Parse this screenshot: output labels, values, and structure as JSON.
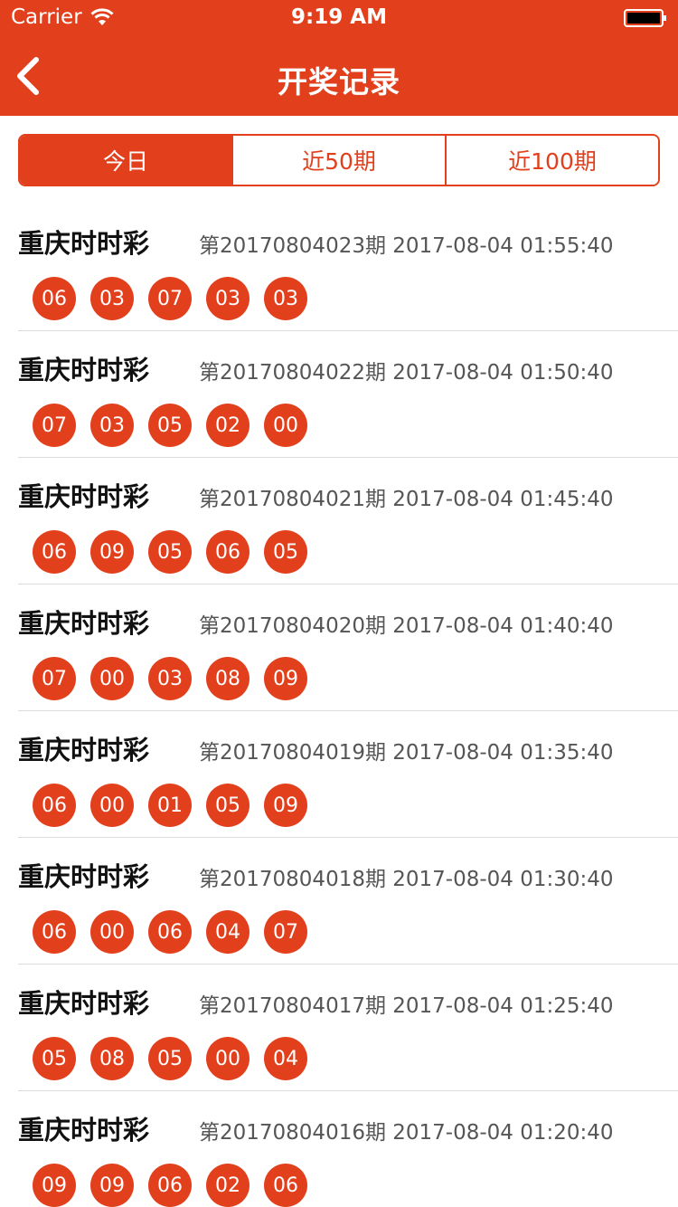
{
  "status": {
    "carrier": "Carrier",
    "time": "9:19 AM"
  },
  "nav": {
    "title": "开奖记录"
  },
  "tabs": [
    {
      "label": "今日",
      "active": true
    },
    {
      "label": "近50期",
      "active": false
    },
    {
      "label": "近100期",
      "active": false
    }
  ],
  "colors": {
    "accent": "#e2401c",
    "divider": "#dcdcdc"
  },
  "records": [
    {
      "name": "重庆时时彩",
      "info": "第20170804023期 2017-08-04 01:55:40",
      "numbers": [
        "06",
        "03",
        "07",
        "03",
        "03"
      ]
    },
    {
      "name": "重庆时时彩",
      "info": "第20170804022期 2017-08-04 01:50:40",
      "numbers": [
        "07",
        "03",
        "05",
        "02",
        "00"
      ]
    },
    {
      "name": "重庆时时彩",
      "info": "第20170804021期 2017-08-04 01:45:40",
      "numbers": [
        "06",
        "09",
        "05",
        "06",
        "05"
      ]
    },
    {
      "name": "重庆时时彩",
      "info": "第20170804020期 2017-08-04 01:40:40",
      "numbers": [
        "07",
        "00",
        "03",
        "08",
        "09"
      ]
    },
    {
      "name": "重庆时时彩",
      "info": "第20170804019期 2017-08-04 01:35:40",
      "numbers": [
        "06",
        "00",
        "01",
        "05",
        "09"
      ]
    },
    {
      "name": "重庆时时彩",
      "info": "第20170804018期 2017-08-04 01:30:40",
      "numbers": [
        "06",
        "00",
        "06",
        "04",
        "07"
      ]
    },
    {
      "name": "重庆时时彩",
      "info": "第20170804017期 2017-08-04 01:25:40",
      "numbers": [
        "05",
        "08",
        "05",
        "00",
        "04"
      ]
    },
    {
      "name": "重庆时时彩",
      "info": "第20170804016期 2017-08-04 01:20:40",
      "numbers": [
        "09",
        "09",
        "06",
        "02",
        "06"
      ]
    }
  ]
}
